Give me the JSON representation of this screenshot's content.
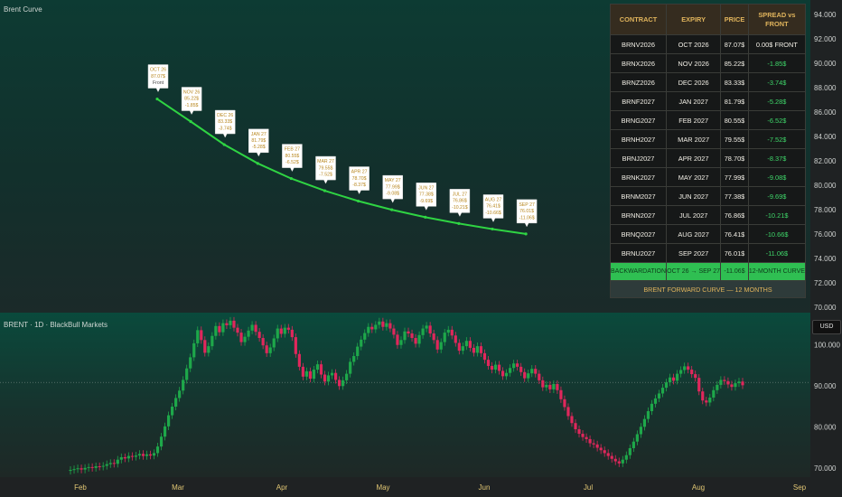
{
  "top_pane": {
    "title": "Brent Curve"
  },
  "bottom_pane": {
    "title": "BRENT · 1D · BlackBull Markets",
    "currency": "USD"
  },
  "top_axis_ticks": [
    "94.000",
    "92.000",
    "90.000",
    "88.000",
    "86.000",
    "84.000",
    "82.000",
    "80.000",
    "78.000",
    "76.000",
    "74.000",
    "72.000",
    "70.000"
  ],
  "bottom_axis_ticks": [
    "100.000",
    "90.000",
    "80.000",
    "70.000"
  ],
  "time_axis": [
    "Feb",
    "Mar",
    "Apr",
    "May",
    "Jun",
    "Jul",
    "Aug",
    "Sep"
  ],
  "table": {
    "headers": [
      "CONTRACT",
      "EXPIRY",
      "PRICE",
      "SPREAD vs FRONT"
    ],
    "rows": [
      {
        "contract": "BRNV2026",
        "expiry": "OCT 2026",
        "price": "87.07$",
        "spread": "0.00$ FRONT"
      },
      {
        "contract": "BRNX2026",
        "expiry": "NOV 2026",
        "price": "85.22$",
        "spread": "-1.85$"
      },
      {
        "contract": "BRNZ2026",
        "expiry": "DEC 2026",
        "price": "83.33$",
        "spread": "-3.74$"
      },
      {
        "contract": "BRNF2027",
        "expiry": "JAN 2027",
        "price": "81.79$",
        "spread": "-5.28$"
      },
      {
        "contract": "BRNG2027",
        "expiry": "FEB 2027",
        "price": "80.55$",
        "spread": "-6.52$"
      },
      {
        "contract": "BRNH2027",
        "expiry": "MAR 2027",
        "price": "79.55$",
        "spread": "-7.52$"
      },
      {
        "contract": "BRNJ2027",
        "expiry": "APR 2027",
        "price": "78.70$",
        "spread": "-8.37$"
      },
      {
        "contract": "BRNK2027",
        "expiry": "MAY 2027",
        "price": "77.99$",
        "spread": "-9.08$"
      },
      {
        "contract": "BRNM2027",
        "expiry": "JUN 2027",
        "price": "77.38$",
        "spread": "-9.69$"
      },
      {
        "contract": "BRNN2027",
        "expiry": "JUL 2027",
        "price": "76.86$",
        "spread": "-10.21$"
      },
      {
        "contract": "BRNQ2027",
        "expiry": "AUG 2027",
        "price": "76.41$",
        "spread": "-10.66$"
      },
      {
        "contract": "BRNU2027",
        "expiry": "SEP 2027",
        "price": "76.01$",
        "spread": "-11.06$"
      }
    ],
    "summary": [
      "BACKWARDATION",
      "OCT 26 → SEP 27",
      "-11.06$",
      "12-MONTH CURVE"
    ],
    "footer": "BRENT FORWARD CURVE — 12 MONTHS"
  },
  "chart_data": [
    {
      "type": "line",
      "title": "Brent Curve",
      "x": [
        "OCT 26",
        "NOV 26",
        "DEC 26",
        "JAN 27",
        "FEB 27",
        "MAR 27",
        "APR 27",
        "MAY 27",
        "JUN 27",
        "JUL 27",
        "AUG 27",
        "SEP 27"
      ],
      "y": [
        87.07,
        85.22,
        83.33,
        81.79,
        80.55,
        79.55,
        78.7,
        77.99,
        77.38,
        76.86,
        76.41,
        76.01
      ],
      "labels": [
        [
          "OCT 26",
          "87.07$",
          "Front"
        ],
        [
          "NOV 26",
          "85.22$",
          "-1.85$"
        ],
        [
          "DEC 26",
          "83.33$",
          "-3.74$"
        ],
        [
          "JAN 27",
          "81.79$",
          "-5.28$"
        ],
        [
          "FEB 27",
          "80.55$",
          "-6.52$"
        ],
        [
          "MAR 27",
          "79.55$",
          "-7.52$"
        ],
        [
          "APR 27",
          "78.70$",
          "-8.37$"
        ],
        [
          "MAY 27",
          "77.99$",
          "-9.08$"
        ],
        [
          "JUN 27",
          "77.38$",
          "-9.69$"
        ],
        [
          "JUL 27",
          "76.86$",
          "-10.21$"
        ],
        [
          "AUG 27",
          "76.41$",
          "-10.66$"
        ],
        [
          "SEP 27",
          "76.01$",
          "-11.06$"
        ]
      ],
      "ylim": [
        70,
        94
      ],
      "line_color": "#2fd443",
      "label_color": "#b8871f"
    },
    {
      "type": "candlestick",
      "title": "BRENT · 1D · BlackBull Markets",
      "x_months": [
        "Feb",
        "Mar",
        "Apr",
        "May",
        "Jun",
        "Jul",
        "Aug",
        "Sep"
      ],
      "ylim": [
        69,
        106
      ],
      "reference_line": 90.8,
      "up_color": "#1ea84a",
      "down_color": "#e0275c",
      "close": [
        69.5,
        69.7,
        69.9,
        69.6,
        70.0,
        70.2,
        70.0,
        70.4,
        70.3,
        70.5,
        70.9,
        71.2,
        71.0,
        72.0,
        72.6,
        72.3,
        72.9,
        72.7,
        73.0,
        73.4,
        72.9,
        73.3,
        73.0,
        73.6,
        75.2,
        77.6,
        80.1,
        82.8,
        84.9,
        87.0,
        88.8,
        91.4,
        94.2,
        96.9,
        100.3,
        103.5,
        101.1,
        98.0,
        99.6,
        102.1,
        104.5,
        103.0,
        105.2,
        104.7,
        105.8,
        104.1,
        102.9,
        100.6,
        101.9,
        103.4,
        104.8,
        103.1,
        101.6,
        99.8,
        97.9,
        99.3,
        101.5,
        103.9,
        102.6,
        104.1,
        103.6,
        101.8,
        97.7,
        94.6,
        92.2,
        93.5,
        91.7,
        93.9,
        95.2,
        92.7,
        91.0,
        92.5,
        93.1,
        91.4,
        89.9,
        91.3,
        92.9,
        95.8,
        97.2,
        99.5,
        101.2,
        102.8,
        104.3,
        103.7,
        104.8,
        105.6,
        104.3,
        105.2,
        103.9,
        102.4,
        99.9,
        101.1,
        103.2,
        102.7,
        101.6,
        100.2,
        102.3,
        103.9,
        104.6,
        102.7,
        101.1,
        98.8,
        100.6,
        102.9,
        103.6,
        102.2,
        100.4,
        98.5,
        99.6,
        100.9,
        99.2,
        98.0,
        99.6,
        97.9,
        96.3,
        94.8,
        93.9,
        95.1,
        93.6,
        92.3,
        93.1,
        94.3,
        95.4,
        94.6,
        93.3,
        91.8,
        93.0,
        94.1,
        92.9,
        91.3,
        89.6,
        90.2,
        89.1,
        90.4,
        88.9,
        86.7,
        84.8,
        82.6,
        80.9,
        79.4,
        78.3,
        77.5,
        77.0,
        76.0,
        75.7,
        74.9,
        74.3,
        73.6,
        72.9,
        72.2,
        71.6,
        71.1,
        72.0,
        73.1,
        74.8,
        76.4,
        78.2,
        80.0,
        81.9,
        83.8,
        85.6,
        86.9,
        88.1,
        89.5,
        90.8,
        92.0,
        91.2,
        92.9,
        93.8,
        94.7,
        93.9,
        92.8,
        91.9,
        88.6,
        86.4,
        85.9,
        87.1,
        88.9,
        90.2,
        91.4,
        91.1,
        90.3,
        89.7,
        90.6,
        91.0,
        90.1
      ],
      "open": [
        69.3,
        69.5,
        69.7,
        69.9,
        69.6,
        70.0,
        70.2,
        70.0,
        70.4,
        70.3,
        70.5,
        70.9,
        71.2,
        71.0,
        72.0,
        72.6,
        72.3,
        72.9,
        72.7,
        73.0,
        73.4,
        72.9,
        73.3,
        73.0,
        73.6,
        75.2,
        77.6,
        80.1,
        82.8,
        84.9,
        87.0,
        88.8,
        91.4,
        94.2,
        96.9,
        100.3,
        103.5,
        101.1,
        98.0,
        99.6,
        102.1,
        104.5,
        103.0,
        105.2,
        104.7,
        105.8,
        104.1,
        102.9,
        100.6,
        101.9,
        103.4,
        104.8,
        103.1,
        101.6,
        99.8,
        97.9,
        99.3,
        101.5,
        103.9,
        102.6,
        104.1,
        103.6,
        101.8,
        97.7,
        94.6,
        92.2,
        93.5,
        91.7,
        93.9,
        95.2,
        92.7,
        91.0,
        92.5,
        93.1,
        91.4,
        89.9,
        91.3,
        92.9,
        95.8,
        97.2,
        99.5,
        101.2,
        102.8,
        104.3,
        103.7,
        104.8,
        105.6,
        104.3,
        105.2,
        103.9,
        102.4,
        99.9,
        101.1,
        103.2,
        102.7,
        101.6,
        100.2,
        102.3,
        103.9,
        104.6,
        102.7,
        101.1,
        98.8,
        100.6,
        102.9,
        103.6,
        102.2,
        100.4,
        98.5,
        99.6,
        100.9,
        99.2,
        98.0,
        99.6,
        97.9,
        96.3,
        94.8,
        93.9,
        95.1,
        93.6,
        92.3,
        93.1,
        94.3,
        95.4,
        94.6,
        93.3,
        91.8,
        93.0,
        94.1,
        92.9,
        91.3,
        89.6,
        90.2,
        89.1,
        90.4,
        88.9,
        86.7,
        84.8,
        82.6,
        80.9,
        79.4,
        78.3,
        77.5,
        77.0,
        76.0,
        75.7,
        74.9,
        74.3,
        73.6,
        72.9,
        72.2,
        71.6,
        71.1,
        72.0,
        73.1,
        74.8,
        76.4,
        78.2,
        80.0,
        81.9,
        83.8,
        85.6,
        86.9,
        88.1,
        89.5,
        90.8,
        92.0,
        91.2,
        92.9,
        93.8,
        94.7,
        93.9,
        92.8,
        91.9,
        88.6,
        86.4,
        85.9,
        87.1,
        88.9,
        90.2,
        91.4,
        91.1,
        90.3,
        89.7,
        90.6,
        91.0
      ]
    }
  ]
}
